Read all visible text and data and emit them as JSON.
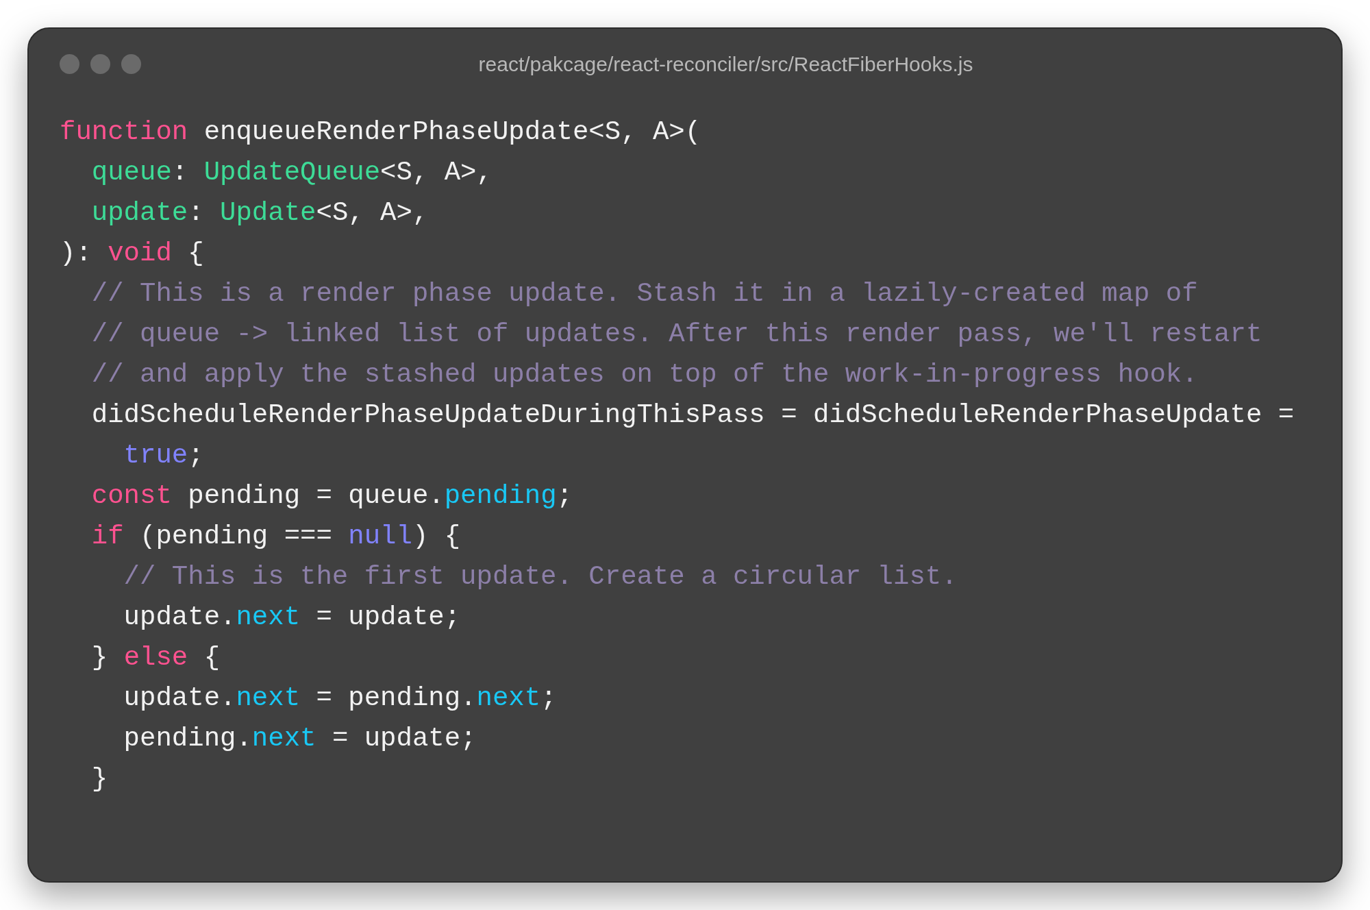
{
  "window": {
    "title": "react/pakcage/react-reconciler/src/ReactFiberHooks.js"
  },
  "code": {
    "lines": [
      [
        {
          "kind": "keyword",
          "text": "function"
        },
        {
          "kind": "plain",
          "text": " enqueueRenderPhaseUpdate<S, A>("
        }
      ],
      [
        {
          "kind": "type",
          "text": "  queue"
        },
        {
          "kind": "plain",
          "text": ": "
        },
        {
          "kind": "type",
          "text": "UpdateQueue"
        },
        {
          "kind": "plain",
          "text": "<S, A>,"
        }
      ],
      [
        {
          "kind": "type",
          "text": "  update"
        },
        {
          "kind": "plain",
          "text": ": "
        },
        {
          "kind": "type",
          "text": "Update"
        },
        {
          "kind": "plain",
          "text": "<S, A>,"
        }
      ],
      [
        {
          "kind": "plain",
          "text": "): "
        },
        {
          "kind": "keyword",
          "text": "void"
        },
        {
          "kind": "plain",
          "text": " {"
        }
      ],
      [
        {
          "kind": "comment",
          "text": "  // This is a render phase update. Stash it in a lazily-created map of"
        }
      ],
      [
        {
          "kind": "comment",
          "text": "  // queue -> linked list of updates. After this render pass, we'll restart"
        }
      ],
      [
        {
          "kind": "comment",
          "text": "  // and apply the stashed updates on top of the work-in-progress hook."
        }
      ],
      [
        {
          "kind": "plain",
          "text": "  didScheduleRenderPhaseUpdateDuringThisPass = didScheduleRenderPhaseUpdate ="
        }
      ],
      [
        {
          "kind": "literal",
          "text": "    true"
        },
        {
          "kind": "plain",
          "text": ";"
        }
      ],
      [
        {
          "kind": "keyword",
          "text": "  const"
        },
        {
          "kind": "plain",
          "text": " pending = queue."
        },
        {
          "kind": "property",
          "text": "pending"
        },
        {
          "kind": "plain",
          "text": ";"
        }
      ],
      [
        {
          "kind": "keyword",
          "text": "  if"
        },
        {
          "kind": "plain",
          "text": " (pending === "
        },
        {
          "kind": "literal",
          "text": "null"
        },
        {
          "kind": "plain",
          "text": ") {"
        }
      ],
      [
        {
          "kind": "comment",
          "text": "    // This is the first update. Create a circular list."
        }
      ],
      [
        {
          "kind": "plain",
          "text": "    update."
        },
        {
          "kind": "property",
          "text": "next"
        },
        {
          "kind": "plain",
          "text": " = update;"
        }
      ],
      [
        {
          "kind": "plain",
          "text": "  } "
        },
        {
          "kind": "keyword",
          "text": "else"
        },
        {
          "kind": "plain",
          "text": " {"
        }
      ],
      [
        {
          "kind": "plain",
          "text": "    update."
        },
        {
          "kind": "property",
          "text": "next"
        },
        {
          "kind": "plain",
          "text": " = pending."
        },
        {
          "kind": "property",
          "text": "next"
        },
        {
          "kind": "plain",
          "text": ";"
        }
      ],
      [
        {
          "kind": "plain",
          "text": "    pending."
        },
        {
          "kind": "property",
          "text": "next"
        },
        {
          "kind": "plain",
          "text": " = update;"
        }
      ],
      [
        {
          "kind": "plain",
          "text": "  }"
        }
      ]
    ]
  }
}
